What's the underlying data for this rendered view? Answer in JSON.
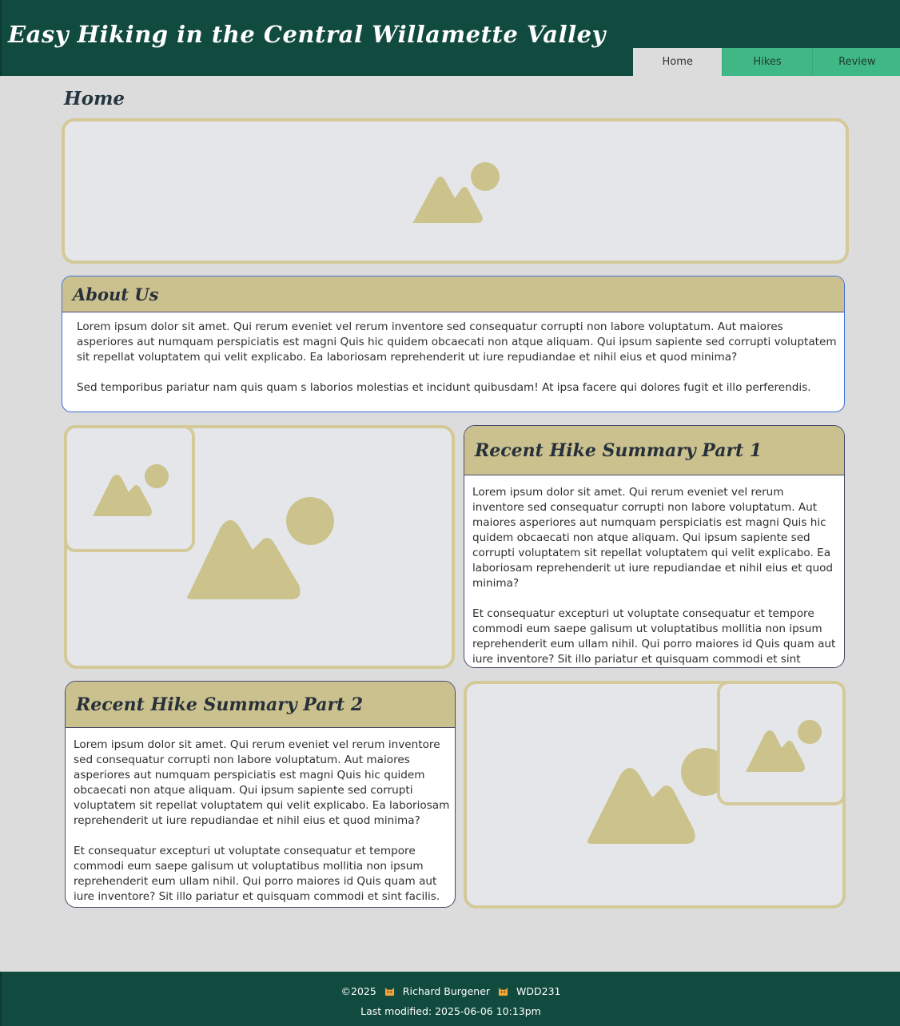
{
  "header": {
    "title": "Easy Hiking in the Central Willamette Valley",
    "nav": [
      {
        "label": "Home",
        "active": true
      },
      {
        "label": "Hikes",
        "active": false
      },
      {
        "label": "Review",
        "active": false
      }
    ]
  },
  "main": {
    "heading": "Home",
    "about": {
      "title": "About Us",
      "paragraphs": [
        "Lorem ipsum dolor sit amet. Qui rerum eveniet vel rerum inventore sed consequatur corrupti non labore voluptatum. Aut maiores asperiores aut numquam perspiciatis est magni Quis hic quidem obcaecati non atque aliquam. Qui ipsum sapiente sed corrupti voluptatem sit repellat voluptatem qui velit explicabo. Ea laboriosam reprehenderit ut iure repudiandae et nihil eius et quod minima?",
        "Sed temporibus pariatur nam quis quam s laborios molestias et incidunt quibusdam! At ipsa facere qui dolores fugit et illo perferendis."
      ]
    },
    "summary1": {
      "title": "Recent Hike Summary Part 1",
      "paragraphs": [
        "Lorem ipsum dolor sit amet. Qui rerum eveniet vel rerum inventore sed consequatur corrupti non labore voluptatum. Aut maiores asperiores aut numquam perspiciatis est magni Quis hic quidem obcaecati non atque aliquam. Qui ipsum sapiente sed corrupti voluptatem sit repellat voluptatem qui velit explicabo. Ea laboriosam reprehenderit ut iure repudiandae et nihil eius et quod minima?",
        "Et consequatur excepturi ut voluptate consequatur et tempore commodi eum saepe galisum ut voluptatibus mollitia non ipsum reprehenderit eum ullam nihil. Qui porro maiores id Quis quam aut iure inventore? Sit illo pariatur et quisquam commodi et sint facilis."
      ]
    },
    "summary2": {
      "title": "Recent Hike Summary Part 2",
      "paragraphs": [
        "Lorem ipsum dolor sit amet. Qui rerum eveniet vel rerum inventore sed consequatur corrupti non labore voluptatum. Aut maiores asperiores aut numquam perspiciatis est magni Quis hic quidem obcaecati non atque aliquam. Qui ipsum sapiente sed corrupti voluptatem sit repellat voluptatem qui velit explicabo. Ea laboriosam reprehenderit ut iure repudiandae et nihil eius et quod minima?",
        "Et consequatur excepturi ut voluptate consequatur et tempore commodi eum saepe galisum ut voluptatibus mollitia non ipsum reprehenderit eum ullam nihil. Qui porro maiores id Quis quam aut iure inventore? Sit illo pariatur et quisquam commodi et sint facilis."
      ]
    },
    "images": {
      "icon": "image-placeholder-icon"
    }
  },
  "footer": {
    "copyright": "©2025",
    "author": "Richard Burgener",
    "course": "WDD231",
    "modified": "Last modified: 2025-06-06 10:13pm",
    "separator_icon": "cat-emoji-icon"
  },
  "colors": {
    "header_bg": "#114a3f",
    "nav_bg": "#40b885",
    "accent_tan": "#cbc18f",
    "frame_border": "#d4c998",
    "page_bg": "#dcdcdc"
  }
}
